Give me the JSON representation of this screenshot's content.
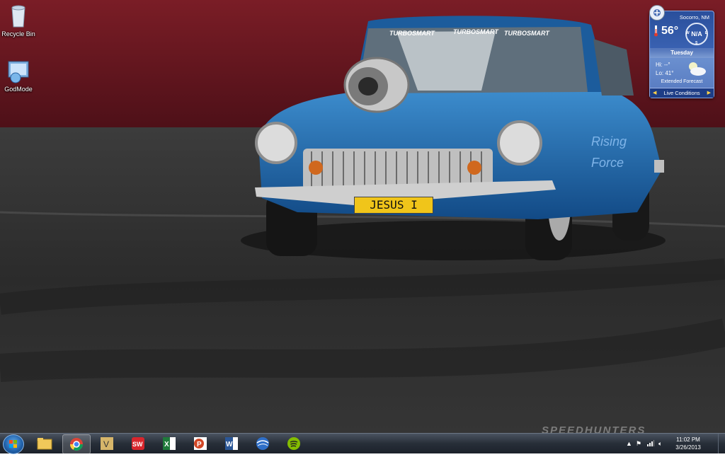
{
  "desktop": {
    "icons": [
      {
        "label": "Recycle Bin",
        "icon": "recycle-bin-icon"
      },
      {
        "label": "GodMode",
        "icon": "control-panel-icon"
      }
    ],
    "wallpaper": {
      "plate_text": "JESUS I",
      "sticker_text": "TURBOSMART",
      "side_text": "Rising Force",
      "watermark": "SPEEDHUNTERS"
    }
  },
  "weather_gadget": {
    "city": "Socorro, NM",
    "temperature": "56°",
    "wind": "N/A",
    "compass_w": "W",
    "compass_e": "E",
    "compass_s": "S",
    "day": "Tuesday",
    "hi": "Hi: --°",
    "lo": "Lo: 41°",
    "extended": "Extended Forecast",
    "footer": "Live Conditions",
    "colors": {
      "panel": "#3a62b2",
      "footer": "#1d3d86",
      "arrow": "#ffd34a"
    }
  },
  "taskbar": {
    "apps": [
      {
        "name": "explorer",
        "icon": "folder-icon"
      },
      {
        "name": "chrome",
        "icon": "chrome-icon",
        "active": true
      },
      {
        "name": "visio",
        "icon": "visio-icon"
      },
      {
        "name": "solidworks",
        "icon": "solidworks-icon"
      },
      {
        "name": "excel",
        "icon": "excel-icon"
      },
      {
        "name": "powerpoint",
        "icon": "powerpoint-icon"
      },
      {
        "name": "word",
        "icon": "word-icon"
      },
      {
        "name": "google-earth",
        "icon": "google-earth-icon"
      },
      {
        "name": "spotify",
        "icon": "spotify-icon"
      }
    ],
    "clock_time": "11:02 PM",
    "clock_date": "3/26/2013"
  }
}
